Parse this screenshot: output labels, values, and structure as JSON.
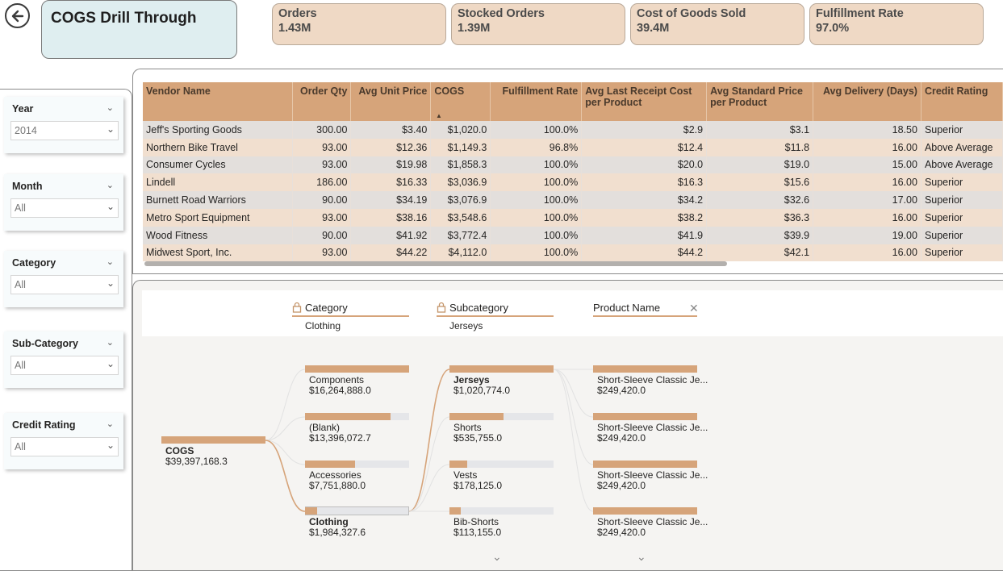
{
  "header": {
    "title": "COGS Drill Through",
    "back_icon": "back-arrow-icon"
  },
  "kpis": [
    {
      "label": "Orders",
      "value": "1.43M"
    },
    {
      "label": "Stocked Orders",
      "value": "1.39M"
    },
    {
      "label": "Cost of Goods Sold",
      "value": "39.4M"
    },
    {
      "label": "Fulfillment Rate",
      "value": "97.0%"
    }
  ],
  "slicers": [
    {
      "title": "Year",
      "value": "2014"
    },
    {
      "title": "Month",
      "value": "All"
    },
    {
      "title": "Category",
      "value": "All"
    },
    {
      "title": "Sub-Category",
      "value": "All"
    },
    {
      "title": "Credit Rating",
      "value": "All"
    }
  ],
  "table": {
    "columns": [
      "Vendor Name",
      "Order Qty",
      "Avg Unit Price",
      "COGS",
      "Fulfillment Rate",
      "Avg Last Receipt Cost per Product",
      "Avg Standard Price per Product",
      "Avg Delivery (Days)",
      "Credit Rating"
    ],
    "rows": [
      [
        "Jeff's Sporting Goods",
        "300.00",
        "$3.40",
        "$1,020.0",
        "100.0%",
        "$2.9",
        "$3.1",
        "18.50",
        "Superior"
      ],
      [
        "Northern Bike Travel",
        "93.00",
        "$12.36",
        "$1,149.3",
        "96.8%",
        "$12.4",
        "$11.8",
        "16.00",
        "Above Average"
      ],
      [
        "Consumer Cycles",
        "93.00",
        "$19.98",
        "$1,858.3",
        "100.0%",
        "$20.0",
        "$19.0",
        "15.00",
        "Above Average"
      ],
      [
        "Lindell",
        "186.00",
        "$16.33",
        "$3,036.9",
        "100.0%",
        "$16.3",
        "$15.6",
        "16.00",
        "Superior"
      ],
      [
        "Burnett Road Warriors",
        "90.00",
        "$34.19",
        "$3,076.9",
        "100.0%",
        "$34.2",
        "$32.6",
        "17.00",
        "Superior"
      ],
      [
        "Metro Sport Equipment",
        "93.00",
        "$38.16",
        "$3,548.6",
        "100.0%",
        "$38.2",
        "$36.3",
        "16.00",
        "Superior"
      ],
      [
        "Wood Fitness",
        "90.00",
        "$41.92",
        "$3,772.4",
        "100.0%",
        "$41.9",
        "$39.9",
        "19.00",
        "Superior"
      ],
      [
        "Midwest Sport, Inc.",
        "93.00",
        "$44.22",
        "$4,112.0",
        "100.0%",
        "$44.2",
        "$42.1",
        "16.00",
        "Superior"
      ]
    ]
  },
  "tree": {
    "levels": [
      {
        "title": "Category",
        "selected": "Clothing",
        "locked": true
      },
      {
        "title": "Subcategory",
        "selected": "Jerseys",
        "locked": true
      },
      {
        "title": "Product Name",
        "selected": "",
        "locked": false
      }
    ],
    "root": {
      "name": "COGS",
      "value": "$39,397,168.3",
      "fraction": 1.0
    },
    "category_nodes": [
      {
        "name": "Components",
        "value": "$16,264,888.0",
        "fraction": 1.0
      },
      {
        "name": "(Blank)",
        "value": "$13,396,072.7",
        "fraction": 0.82
      },
      {
        "name": "Accessories",
        "value": "$7,751,880.0",
        "fraction": 0.48
      },
      {
        "name": "Clothing",
        "value": "$1,984,327.6",
        "fraction": 0.12
      }
    ],
    "subcategory_nodes": [
      {
        "name": "Jerseys",
        "value": "$1,020,774.0",
        "fraction": 1.0
      },
      {
        "name": "Shorts",
        "value": "$535,755.0",
        "fraction": 0.52
      },
      {
        "name": "Vests",
        "value": "$178,125.0",
        "fraction": 0.17
      },
      {
        "name": "Bib-Shorts",
        "value": "$113,155.0",
        "fraction": 0.11
      }
    ],
    "product_nodes": [
      {
        "name": "Short-Sleeve Classic Je...",
        "value": "$249,420.0",
        "fraction": 1.0
      },
      {
        "name": "Short-Sleeve Classic Je...",
        "value": "$249,420.0",
        "fraction": 1.0
      },
      {
        "name": "Short-Sleeve Classic Je...",
        "value": "$249,420.0",
        "fraction": 1.0
      },
      {
        "name": "Short-Sleeve Classic Je...",
        "value": "$249,420.0",
        "fraction": 1.0
      }
    ]
  },
  "colors": {
    "accent": "#d6a47a",
    "kpi_bg": "#efd9c5",
    "title_bg": "#dfeef0",
    "row_odd": "#e3dfdc",
    "row_even": "#f1dfcf"
  }
}
